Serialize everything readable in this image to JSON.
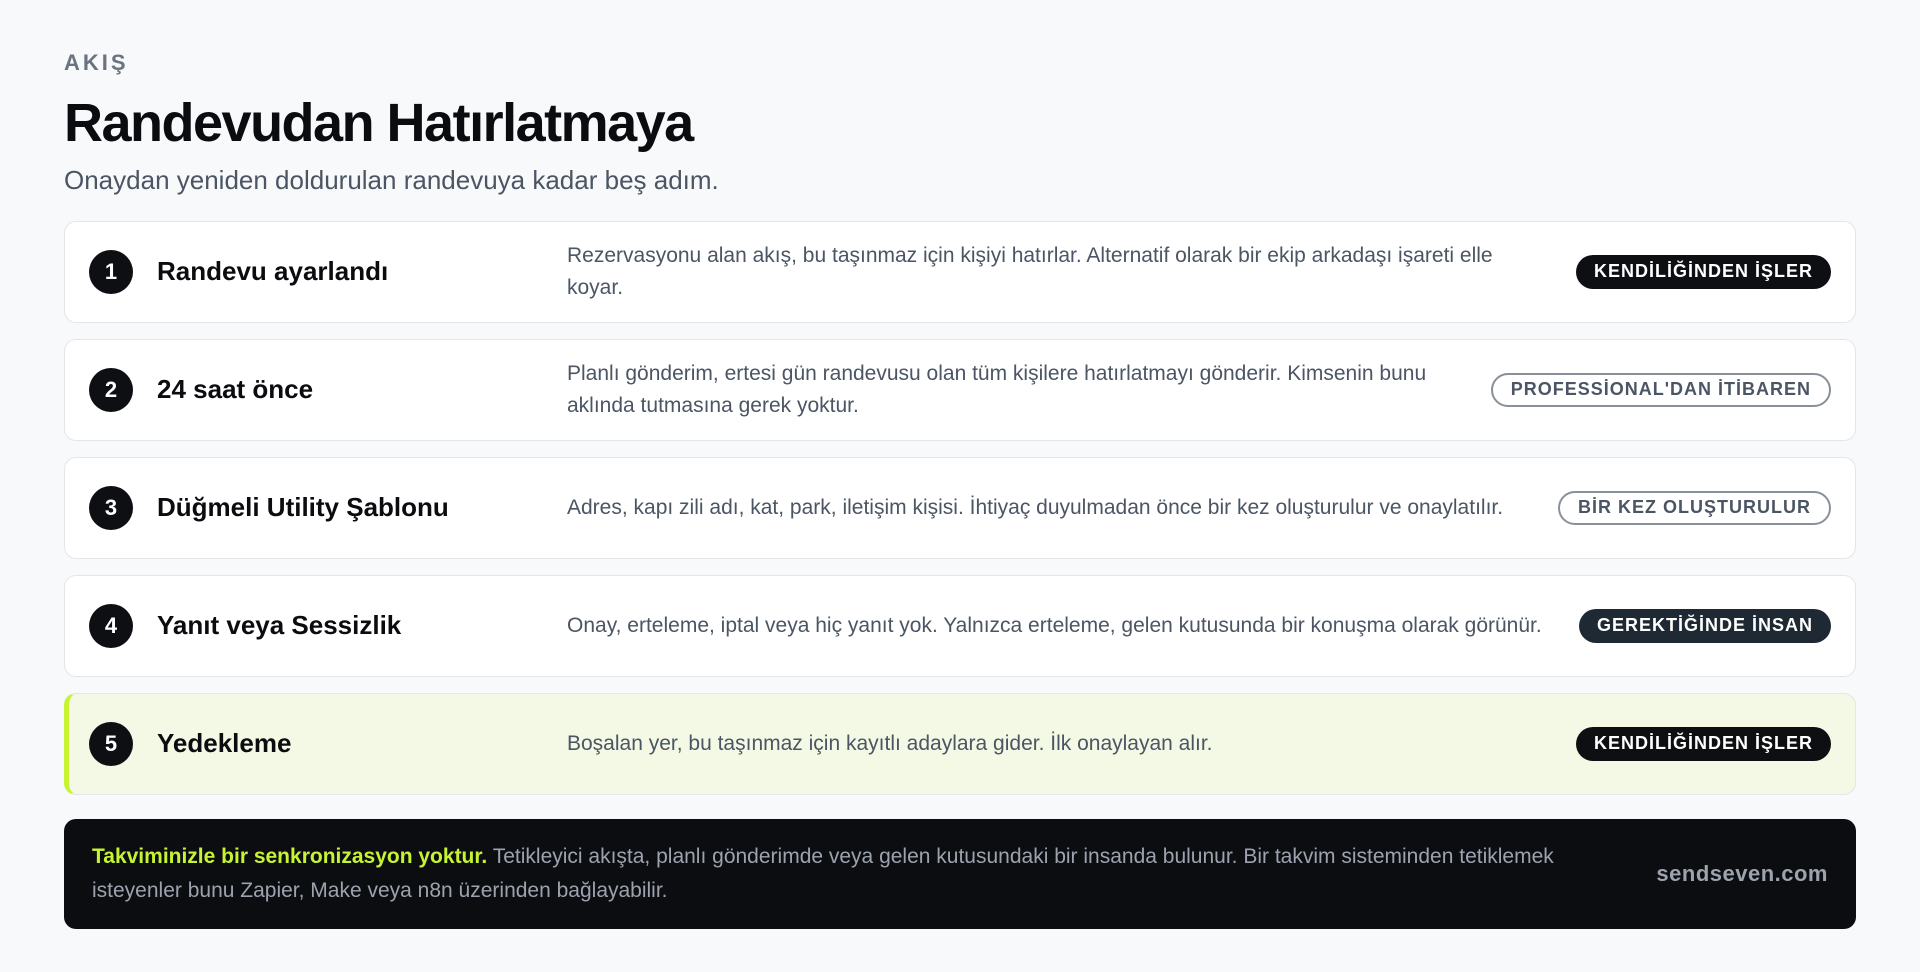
{
  "header": {
    "eyebrow": "AKIŞ",
    "title": "Randevudan Hatırlatmaya",
    "subtitle": "Onaydan yeniden doldurulan randevuya kadar beş adım."
  },
  "steps": [
    {
      "number": "1",
      "title": "Randevu ayarlandı",
      "description": "Rezervasyonu alan akış, bu taşınmaz için kişiyi hatırlar. Alternatif olarak bir ekip arkadaşı işareti elle koyar.",
      "badge": "KENDİLİĞİNDEN İŞLER"
    },
    {
      "number": "2",
      "title": "24 saat önce",
      "description": "Planlı gönderim, ertesi gün randevusu olan tüm kişilere hatırlatmayı gönderir. Kimsenin bunu aklında tutmasına gerek yoktur.",
      "badge": "PROFESSİONAL'DAN İTİBAREN"
    },
    {
      "number": "3",
      "title": "Düğmeli Utility Şablonu",
      "description": "Adres, kapı zili adı, kat, park, iletişim kişisi. İhtiyaç duyulmadan önce bir kez oluşturulur ve onaylatılır.",
      "badge": "BİR KEZ OLUŞTURULUR"
    },
    {
      "number": "4",
      "title": "Yanıt veya Sessizlik",
      "description": "Onay, erteleme, iptal veya hiç yanıt yok. Yalnızca erteleme, gelen kutusunda bir konuşma olarak görünür.",
      "badge": "GEREKTİĞİNDE İNSAN"
    },
    {
      "number": "5",
      "title": "Yedekleme",
      "description": "Boşalan yer, bu taşınmaz için kayıtlı adaylara gider. İlk onaylayan alır.",
      "badge": "KENDİLİĞİNDEN İŞLER"
    }
  ],
  "footer": {
    "strong": "Takviminizle bir senkronizasyon yoktur.",
    "text": "Tetikleyici akışta, planlı gönderimde veya gelen kutusundaki bir insanda bulunur. Bir takvim sisteminden tetiklemek isteyenler bunu Zapier, Make veya n8n üzerinden bağlayabilir.",
    "link": "sendseven.com"
  },
  "colors": {
    "accent": "#c6f432",
    "highlight_bg": "#f3f9e4",
    "dark": "#0d0f12"
  }
}
